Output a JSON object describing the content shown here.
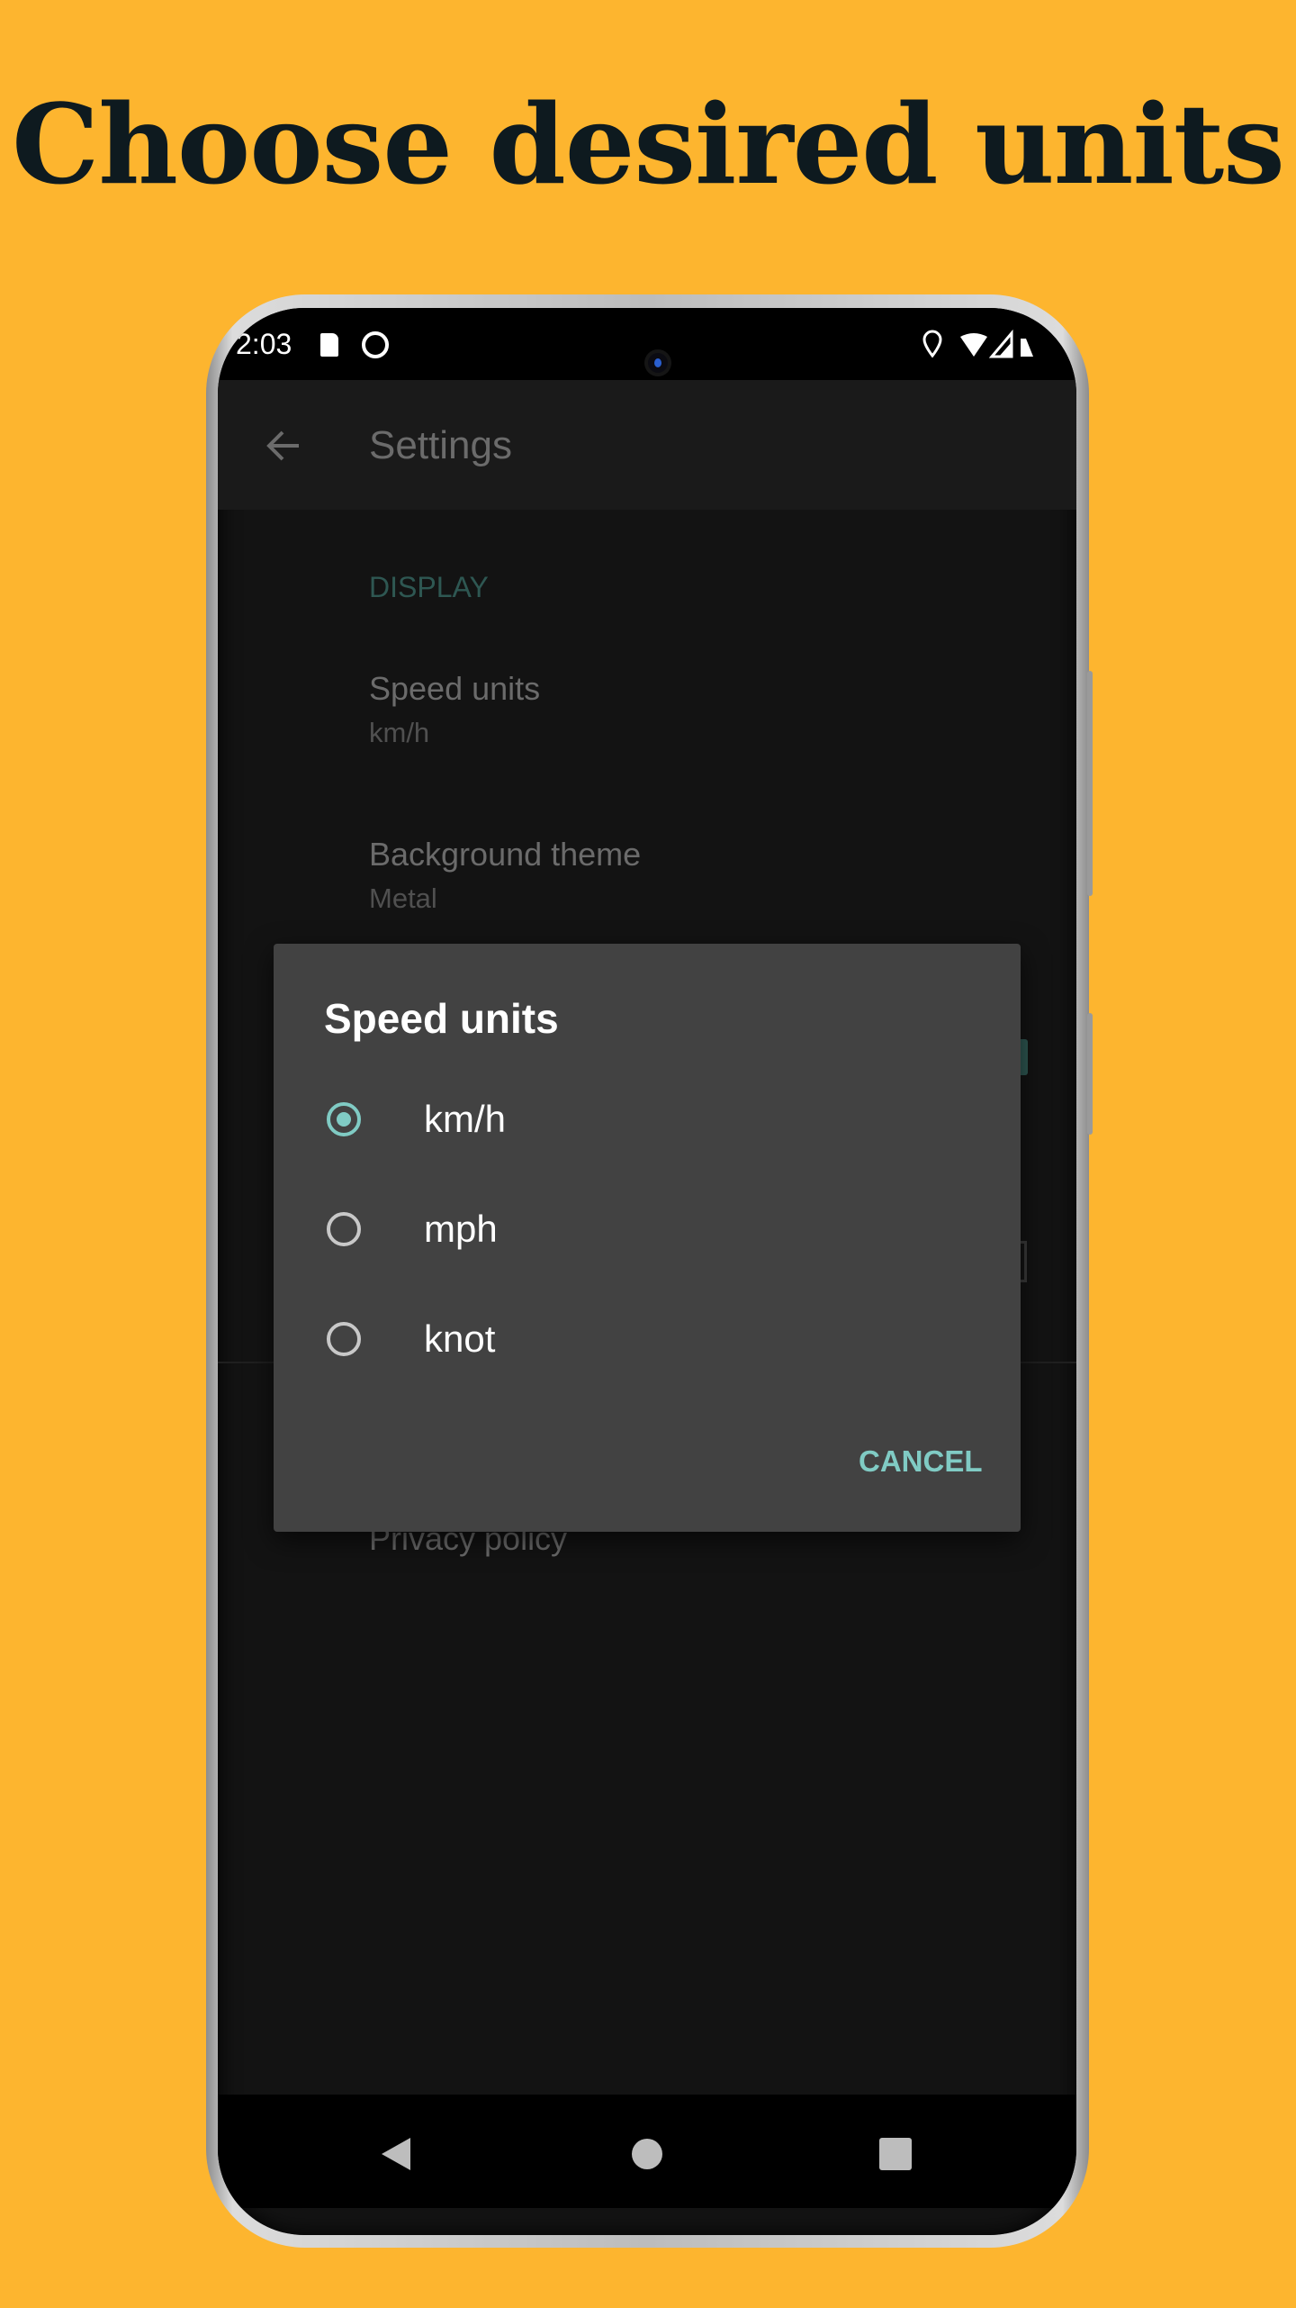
{
  "headline": "Choose desired units",
  "status_bar": {
    "time": "2:03",
    "icons": [
      "sd-card-icon",
      "app-notification-icon",
      "location-icon",
      "wifi-icon",
      "signal-icon",
      "battery-icon"
    ]
  },
  "app_bar": {
    "title": "Settings",
    "back_icon": "arrow-left-icon"
  },
  "settings": {
    "section": "DISPLAY",
    "items": [
      {
        "title": "Speed units",
        "summary": "km/h"
      },
      {
        "title": "Background theme",
        "summary": "Metal"
      },
      {
        "title": "Privacy policy"
      }
    ]
  },
  "dialog": {
    "title": "Speed units",
    "options": [
      {
        "label": "km/h",
        "selected": true
      },
      {
        "label": "mph",
        "selected": false
      },
      {
        "label": "knot",
        "selected": false
      }
    ],
    "cancel_label": "CANCEL"
  },
  "nav_bar": {
    "icons": [
      "back-triangle-icon",
      "home-circle-icon",
      "recents-square-icon"
    ]
  },
  "colors": {
    "background": "#fdb52f",
    "accent": "#80cbc4",
    "dialog": "#424242",
    "screen": "#131313"
  }
}
